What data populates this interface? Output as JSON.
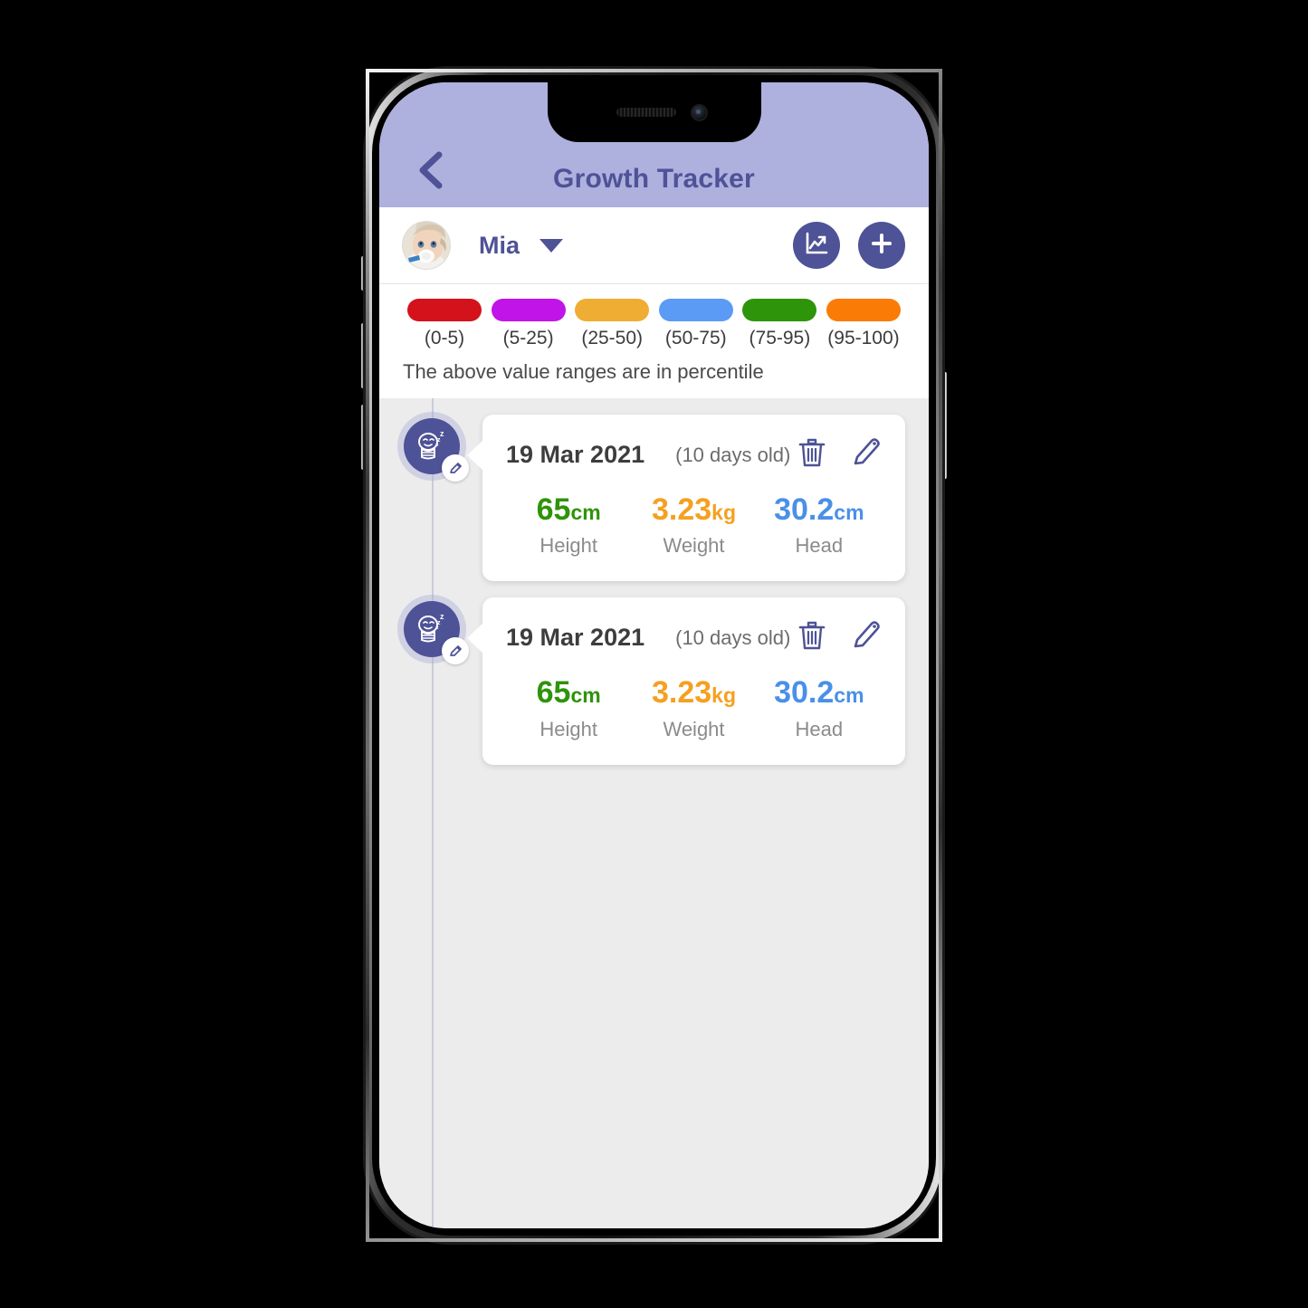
{
  "app": {
    "title": "Growth Tracker",
    "back_icon": "chevron-left-icon",
    "header_bg": "#aeb0de",
    "accent": "#4e5296"
  },
  "child_bar": {
    "avatar_icon": "baby-avatar",
    "name": "Mia",
    "dropdown_icon": "caret-down-icon",
    "chart_button_icon": "chart-line-icon",
    "add_button_icon": "plus-icon"
  },
  "legend": {
    "note": "The above value ranges are in percentile",
    "items": [
      {
        "label": "(0-5)",
        "color": "#d4121c"
      },
      {
        "label": "(5-25)",
        "color": "#c014e8"
      },
      {
        "label": "(25-50)",
        "color": "#f0ad33"
      },
      {
        "label": "(50-75)",
        "color": "#5b9bf5"
      },
      {
        "label": "(75-95)",
        "color": "#2e9409"
      },
      {
        "label": "(95-100)",
        "color": "#fa7b06"
      }
    ]
  },
  "entries": [
    {
      "badge_icon": "sleeping-baby-icon",
      "badge_edit_icon": "pencil-icon",
      "date": "19 Mar 2021",
      "age": "(10 days old)",
      "delete_icon": "trash-icon",
      "edit_icon": "pencil-icon",
      "metrics": [
        {
          "value": "65",
          "unit": "cm",
          "label": "Height",
          "color": "#2e9409"
        },
        {
          "value": "3.23",
          "unit": "kg",
          "label": "Weight",
          "color": "#f5a020"
        },
        {
          "value": "30.2",
          "unit": "cm",
          "label": "Head",
          "color": "#4a90e8"
        }
      ]
    },
    {
      "badge_icon": "sleeping-baby-icon",
      "badge_edit_icon": "pencil-icon",
      "date": "19 Mar 2021",
      "age": "(10 days old)",
      "delete_icon": "trash-icon",
      "edit_icon": "pencil-icon",
      "metrics": [
        {
          "value": "65",
          "unit": "cm",
          "label": "Height",
          "color": "#2e9409"
        },
        {
          "value": "3.23",
          "unit": "kg",
          "label": "Weight",
          "color": "#f5a020"
        },
        {
          "value": "30.2",
          "unit": "cm",
          "label": "Head",
          "color": "#4a90e8"
        }
      ]
    }
  ]
}
